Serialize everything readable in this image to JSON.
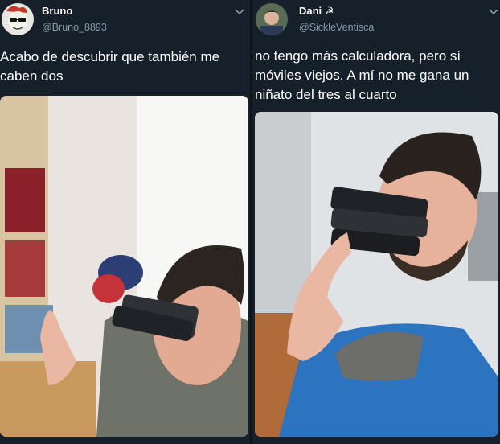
{
  "tweets": [
    {
      "display_name": "Bruno",
      "handle": "@Bruno_8893",
      "avatar_icon": "avatar-sunglasses-cartoon-icon",
      "text_lines": [
        "Acabo de descubrir que también me",
        "caben dos"
      ],
      "photo": {
        "description_icon": "selfie-phones-in-mouth-photo"
      }
    },
    {
      "display_name": "Dani",
      "name_suffix_icon": "☭",
      "handle": "@SickleVentisca",
      "avatar_icon": "avatar-photo-icon",
      "text_lines": [
        "no tengo más calculadora, pero sí",
        "móviles viejos. A mí no me gana un",
        "niñato del tres al cuarto"
      ],
      "photo": {
        "description_icon": "selfie-phones-in-mouth-photo"
      }
    }
  ],
  "colors": {
    "background": "#15202b",
    "text_primary": "#ffffff",
    "text_secondary": "#8899a6"
  }
}
